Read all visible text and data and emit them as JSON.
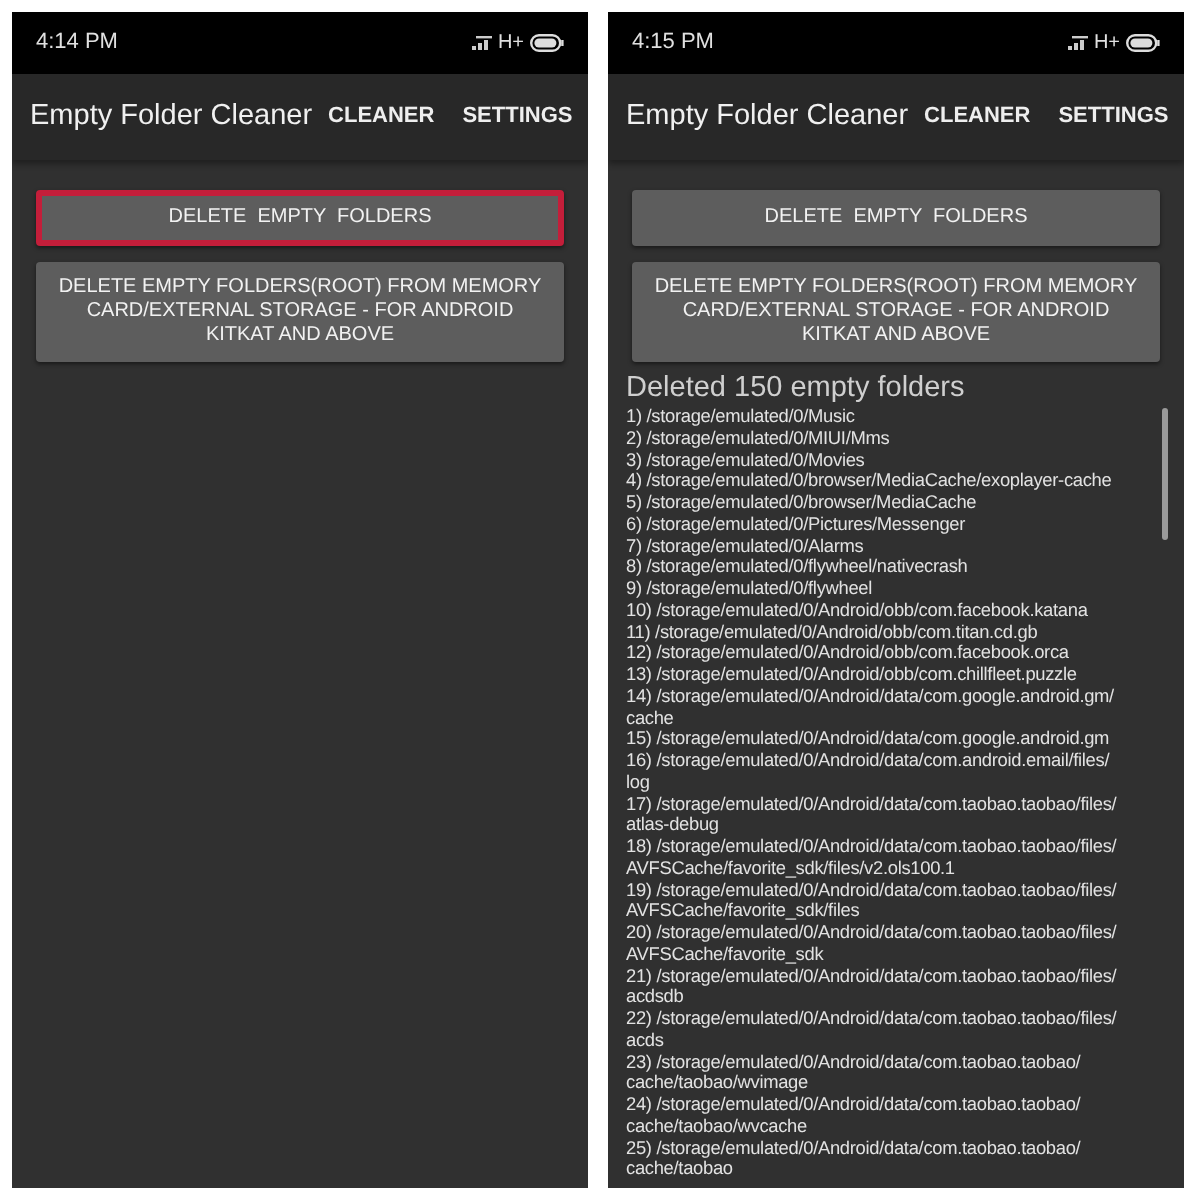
{
  "screens": [
    {
      "status_bar": {
        "time": "4:14 PM",
        "network": "H+"
      },
      "app_bar": {
        "title": "Empty Folder Cleaner",
        "actions": [
          "CLEANER",
          "SETTINGS"
        ]
      },
      "buttons": [
        {
          "label": "DELETE  EMPTY  FOLDERS",
          "focused": true
        },
        {
          "label": "DELETE EMPTY FOLDERS(ROOT) FROM MEMORY CARD/EXTERNAL STORAGE - FOR ANDROID KITKAT AND ABOVE",
          "focused": false
        }
      ]
    },
    {
      "status_bar": {
        "time": "4:15 PM",
        "network": "H+"
      },
      "app_bar": {
        "title": "Empty Folder Cleaner",
        "actions": [
          "CLEANER",
          "SETTINGS"
        ]
      },
      "buttons": [
        {
          "label": "DELETE  EMPTY  FOLDERS",
          "focused": false
        },
        {
          "label": "DELETE EMPTY FOLDERS(ROOT) FROM MEMORY CARD/EXTERNAL STORAGE - FOR ANDROID KITKAT AND ABOVE",
          "focused": false
        }
      ],
      "result": {
        "heading": "Deleted 150 empty folders",
        "entries": [
          "1) /storage/emulated/0/Music",
          "2) /storage/emulated/0/MIUI/Mms",
          "3) /storage/emulated/0/Movies",
          "4) /storage/emulated/0/browser/MediaCache/exoplayer-cache",
          "5) /storage/emulated/0/browser/MediaCache",
          "6) /storage/emulated/0/Pictures/Messenger",
          "7) /storage/emulated/0/Alarms",
          "8) /storage/emulated/0/flywheel/nativecrash",
          "9) /storage/emulated/0/flywheel",
          "10) /storage/emulated/0/Android/obb/com.facebook.katana",
          "11) /storage/emulated/0/Android/obb/com.titan.cd.gb",
          "12) /storage/emulated/0/Android/obb/com.facebook.orca",
          "13) /storage/emulated/0/Android/obb/com.chillfleet.puzzle",
          "14) /storage/emulated/0/Android/data/com.google.android.gm/\ncache",
          "15) /storage/emulated/0/Android/data/com.google.android.gm",
          "16) /storage/emulated/0/Android/data/com.android.email/files/\nlog",
          "17) /storage/emulated/0/Android/data/com.taobao.taobao/files/\natlas-debug",
          "18) /storage/emulated/0/Android/data/com.taobao.taobao/files/\nAVFSCache/favorite_sdk/files/v2.ols100.1",
          "19) /storage/emulated/0/Android/data/com.taobao.taobao/files/\nAVFSCache/favorite_sdk/files",
          "20) /storage/emulated/0/Android/data/com.taobao.taobao/files/\nAVFSCache/favorite_sdk",
          "21) /storage/emulated/0/Android/data/com.taobao.taobao/files/\nacdsdb",
          "22) /storage/emulated/0/Android/data/com.taobao.taobao/files/\nacds",
          "23) /storage/emulated/0/Android/data/com.taobao.taobao/\ncache/taobao/wvimage",
          "24) /storage/emulated/0/Android/data/com.taobao.taobao/\ncache/taobao/wvcache",
          "25) /storage/emulated/0/Android/data/com.taobao.taobao/\ncache/taobao"
        ]
      }
    }
  ]
}
